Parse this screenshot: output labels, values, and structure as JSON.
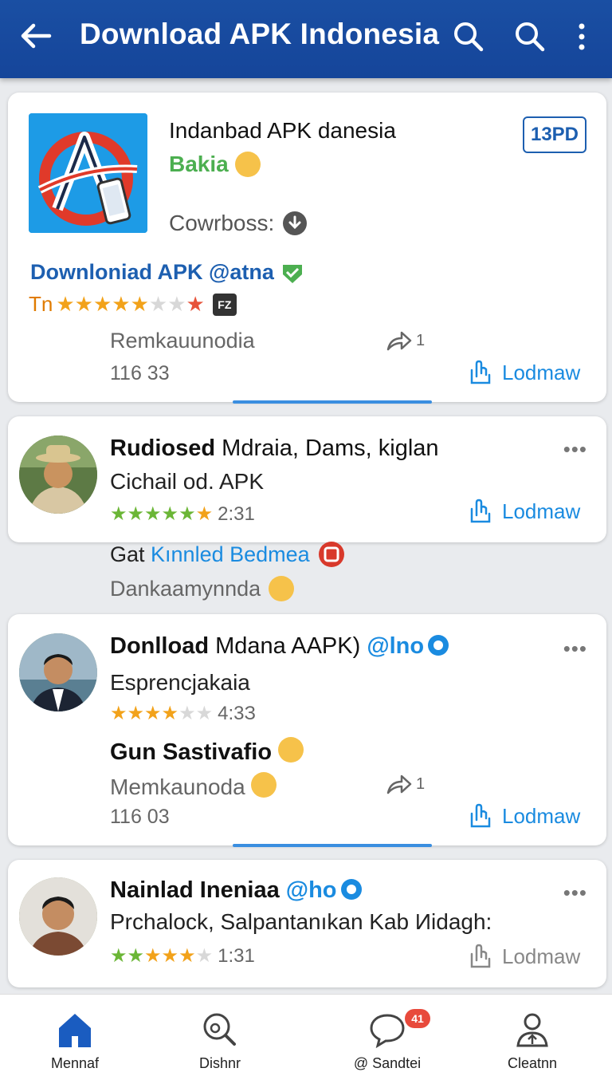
{
  "appbar": {
    "title": "Download APK  Indonesia",
    "icons": [
      "back-arrow-icon",
      "search-icon",
      "search-icon",
      "more-vert-icon"
    ]
  },
  "app_card": {
    "name": "Indanbad APK danesia",
    "subtitle": "Bakia",
    "developer": "Cowrboss:",
    "badge": "13PD",
    "link": "Downloniad APK @atna",
    "rating_prefix": "Tn",
    "rating_chip": "FZ",
    "meta_1": "Remkauunodia",
    "meta_2": "116 33",
    "share_count": "1",
    "download_label": "Lodmaw"
  },
  "review_1": {
    "name": "Rudiosed",
    "title_rest": " Mdraia, Dams, kiglan",
    "line": "Cichail od. APK",
    "time": "2:31",
    "download_label": "Lodmaw"
  },
  "between": {
    "line_1_plain": "Gat ",
    "line_1_blue": "Kınnled Bedmea",
    "line_2": "Dankaamynnda"
  },
  "review_2": {
    "name": "Donlload",
    "title_rest": " Mdana AAPK)",
    "handle": "@lno",
    "line": "Esprencjakaia",
    "time": "4:3З",
    "sub_title": "Gun Sastivafio",
    "meta_1": "Memkaunoda",
    "meta_2": "116 03",
    "share_count": "1",
    "download_label": "Lodmaw"
  },
  "review_3": {
    "name": "Nainlad Ineniaa",
    "handle": "@ho",
    "line": "Prchalock, Salpantanıkan Kab Иidagh:",
    "time": "1:31",
    "download_label": "Lodmaw"
  },
  "bottom_nav": {
    "notif_count": "41",
    "items": [
      {
        "icon": "home-icon",
        "label": "Mennaf"
      },
      {
        "icon": "search-discover-icon",
        "label": "Dishnr"
      },
      {
        "icon": "chat-icon",
        "label": "@ Sandtei"
      },
      {
        "icon": "profile-icon",
        "label": "Cleatnn"
      }
    ]
  },
  "colors": {
    "appbar": "#1a4fa3",
    "accent_blue": "#1a8be0",
    "green": "#4caf50",
    "star_orange": "#f2a21a"
  }
}
